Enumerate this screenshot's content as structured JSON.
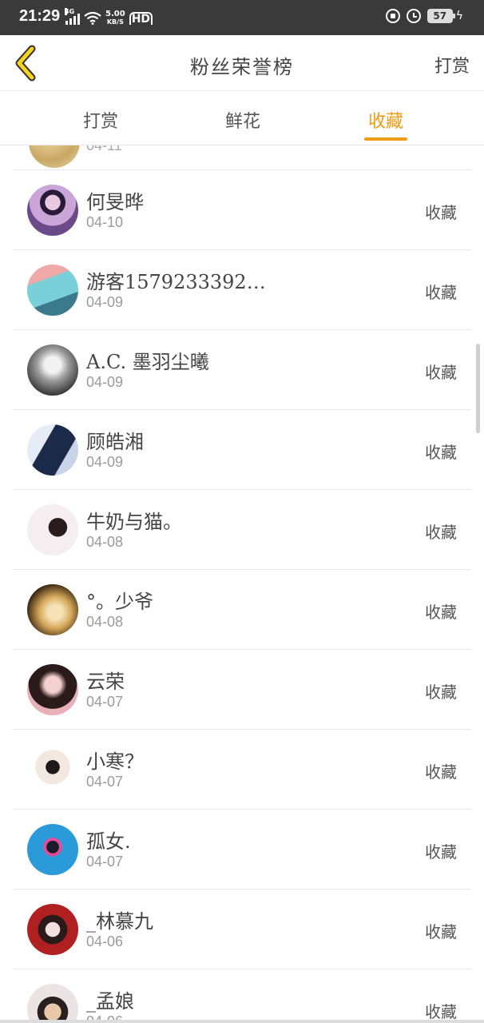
{
  "status_bar": {
    "time": "21:29",
    "network": "4G",
    "speed_value": "5.00",
    "speed_unit": "KB/S",
    "hd": "HD",
    "battery": "57"
  },
  "header": {
    "title": "粉丝荣誉榜",
    "action": "打赏"
  },
  "tabs": [
    {
      "label": "打赏",
      "active": false
    },
    {
      "label": "鲜花",
      "active": false
    },
    {
      "label": "收藏",
      "active": true
    }
  ],
  "colors": {
    "accent": "#f19a14",
    "status_bar": "#3a3a3a"
  },
  "list": [
    {
      "name": "何旻晔",
      "date": "04-10",
      "action": "收藏"
    },
    {
      "name": "游客1579233392…",
      "date": "04-09",
      "action": "收藏"
    },
    {
      "name": "A.C. 墨羽尘曦",
      "date": "04-09",
      "action": "收藏"
    },
    {
      "name": "顾皓湘",
      "date": "04-09",
      "action": "收藏"
    },
    {
      "name": "牛奶与猫。",
      "date": "04-08",
      "action": "收藏"
    },
    {
      "name": "°。少爷",
      "date": "04-08",
      "action": "收藏"
    },
    {
      "name": "云荣",
      "date": "04-07",
      "action": "收藏"
    },
    {
      "name": "小寒？",
      "date": "04-07",
      "action": "收藏"
    },
    {
      "name": "孤女.",
      "date": "04-07",
      "action": "收藏"
    },
    {
      "name": "_林慕九",
      "date": "04-06",
      "action": "收藏"
    },
    {
      "name": "_孟娘",
      "date": "04-06",
      "action": "收藏"
    }
  ]
}
